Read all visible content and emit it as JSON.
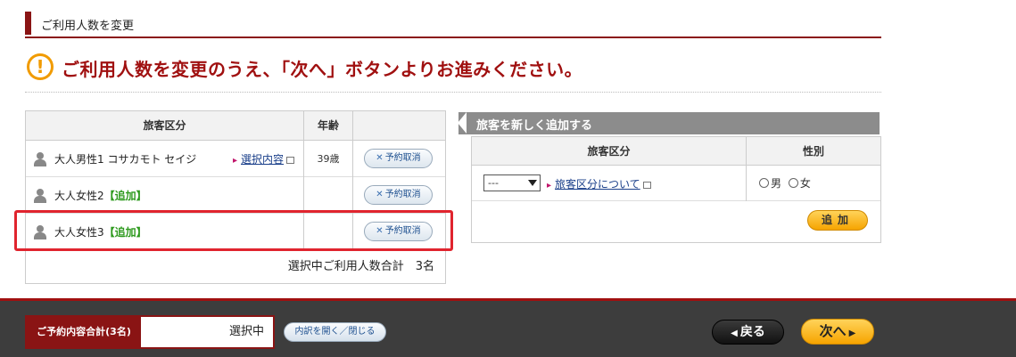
{
  "section": {
    "title": "ご利用人数を変更"
  },
  "notice": {
    "icon": "exclamation-icon",
    "message": "ご利用人数を変更のうえ、「次へ」ボタンよりお進みください。"
  },
  "travelers_table": {
    "headers": [
      "旅客区分",
      "年齢",
      ""
    ],
    "rows": [
      {
        "name": "大人男性1 コサカモト セイジ",
        "add_tag": "",
        "link": "選択内容",
        "age": "39歳",
        "cancel": "予約取消"
      },
      {
        "name": "大人女性2",
        "add_tag": "【追加】",
        "link": "",
        "age": "",
        "cancel": "予約取消"
      },
      {
        "name": "大人女性3",
        "add_tag": "【追加】",
        "link": "",
        "age": "",
        "cancel": "予約取消"
      }
    ],
    "total": "選択中ご利用人数合計　3名"
  },
  "add_panel": {
    "title": "旅客を新しく追加する",
    "headers": [
      "旅客区分",
      "性別"
    ],
    "select_value": "---",
    "class_link": "旅客区分について",
    "gender_male": "男",
    "gender_female": "女",
    "add_button": "追加"
  },
  "footer": {
    "summary_label": "ご予約内容合計(3名)",
    "summary_value": "選択中",
    "detail_button": "内訳を開く／閉じる",
    "back_button": "戻る",
    "next_button": "次へ"
  },
  "colors": {
    "brand": "#8a1414",
    "accent": "#f6a400",
    "highlight": "#e0242e",
    "add": "#2e9a1e"
  }
}
